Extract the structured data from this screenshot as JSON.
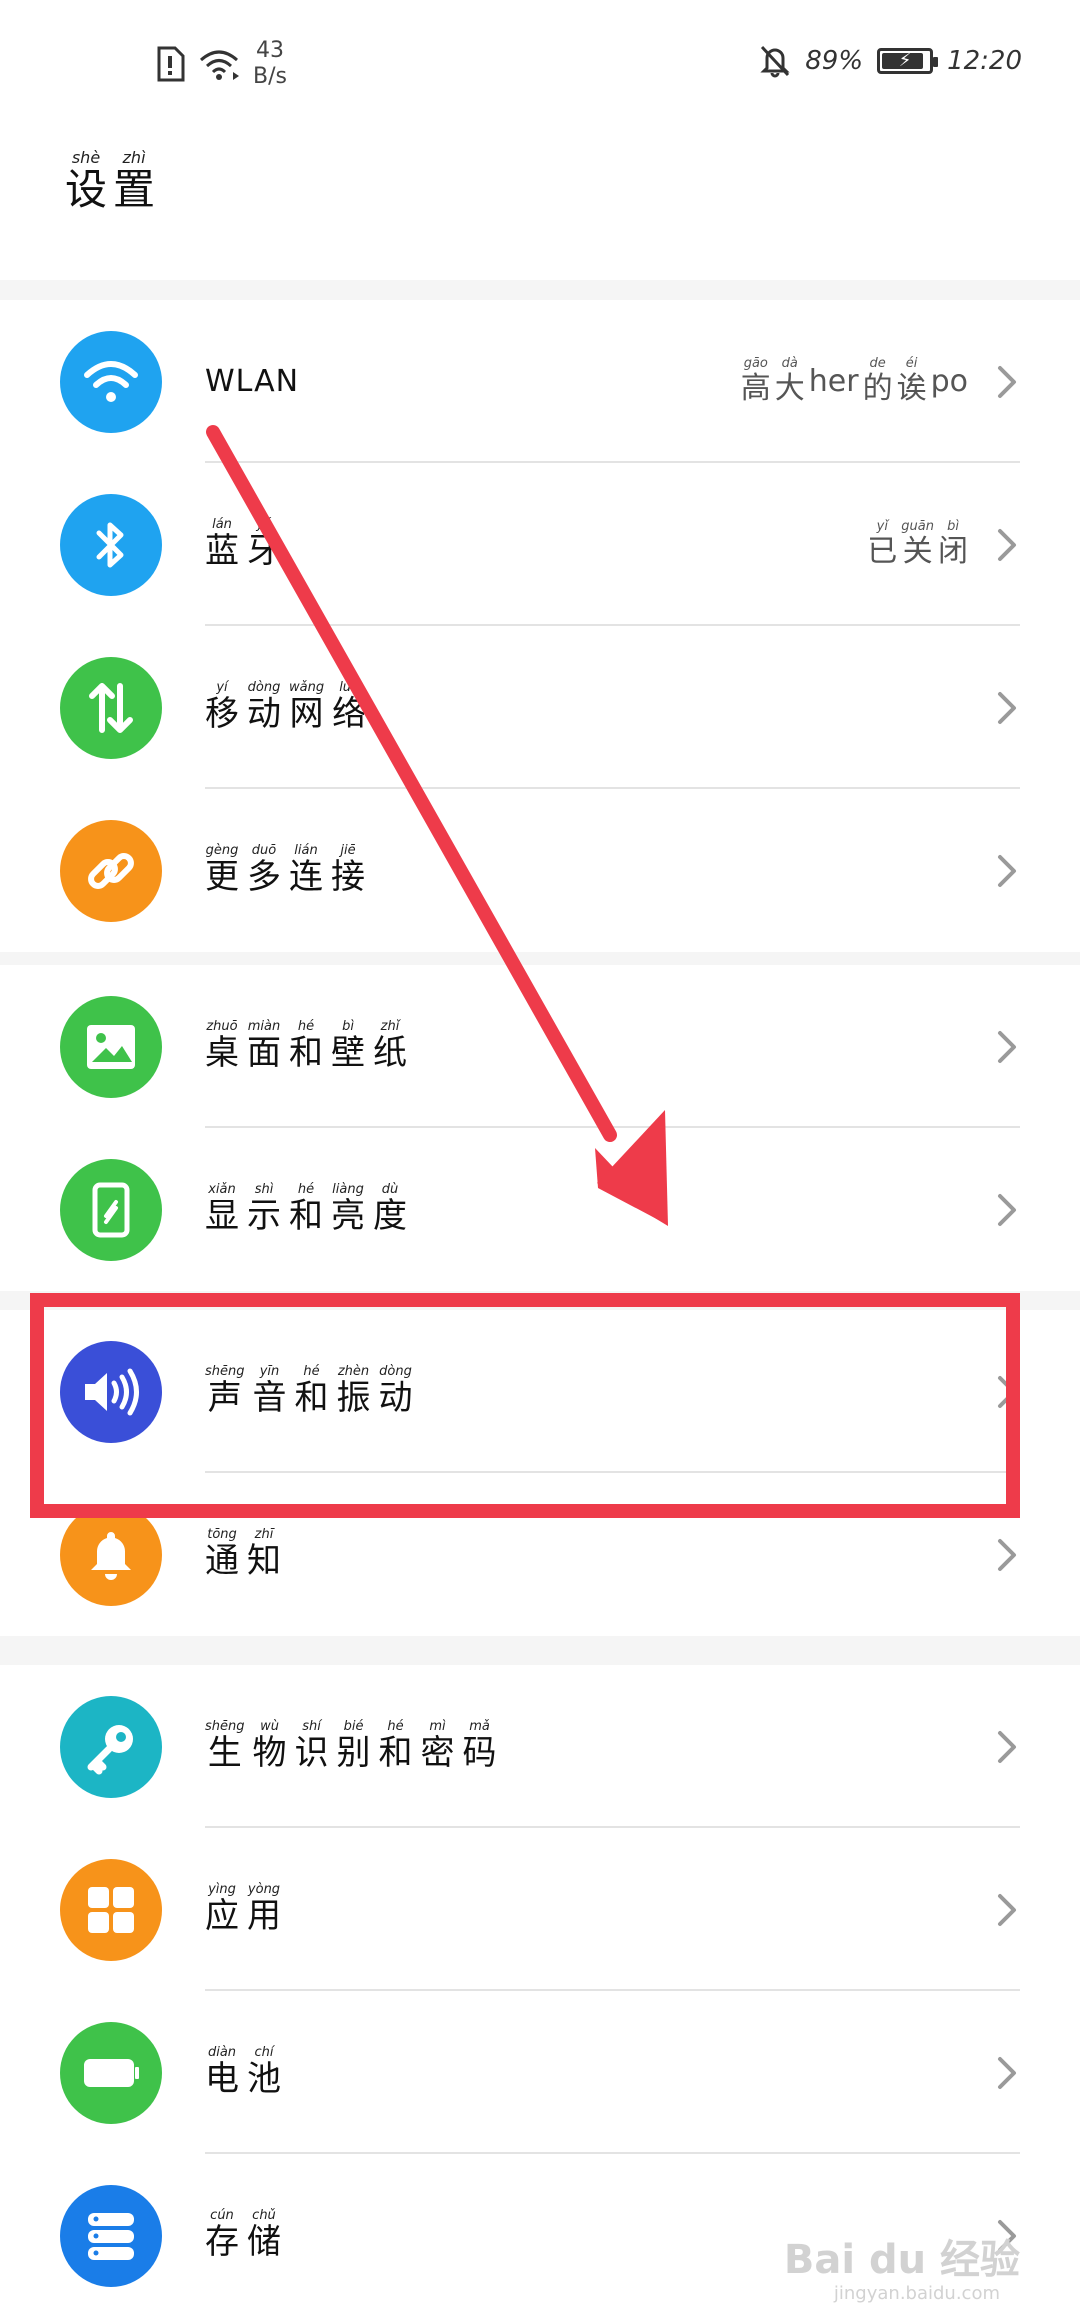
{
  "status_bar": {
    "net_speed_value": "43",
    "net_speed_unit": "B/s",
    "battery": "89%",
    "battery_level": 0.89,
    "time": "12:20"
  },
  "title": {
    "chars": [
      {
        "c": "设",
        "p": "shè"
      },
      {
        "c": "置",
        "p": "zhì"
      }
    ]
  },
  "groups": [
    {
      "rows": [
        {
          "id": "wlan",
          "icon": "wifi-icon",
          "color": "#1fa3f0",
          "label_plain": "WLAN",
          "value": [
            {
              "c": "高",
              "p": "gāo"
            },
            {
              "c": "大",
              "p": "dà"
            },
            {
              "c": "her",
              "p": ""
            },
            {
              "c": "的",
              "p": "de"
            },
            {
              "c": "诶",
              "p": "éi"
            },
            {
              "c": "po",
              "p": ""
            }
          ]
        },
        {
          "id": "bluetooth",
          "icon": "bluetooth-icon",
          "color": "#1fa3f0",
          "label": [
            {
              "c": "蓝",
              "p": "lán"
            },
            {
              "c": "牙",
              "p": "yá"
            }
          ],
          "value": [
            {
              "c": "已",
              "p": "yǐ"
            },
            {
              "c": "关",
              "p": "guān"
            },
            {
              "c": "闭",
              "p": "bì"
            }
          ]
        },
        {
          "id": "mobile-network",
          "icon": "mobile-data-icon",
          "color": "#3fc24a",
          "label": [
            {
              "c": "移",
              "p": "yí"
            },
            {
              "c": "动",
              "p": "dòng"
            },
            {
              "c": "网",
              "p": "wǎng"
            },
            {
              "c": "络",
              "p": "luò"
            }
          ]
        },
        {
          "id": "more-connections",
          "icon": "link-icon",
          "color": "#f7931a",
          "label": [
            {
              "c": "更",
              "p": "gèng"
            },
            {
              "c": "多",
              "p": "duō"
            },
            {
              "c": "连",
              "p": "lián"
            },
            {
              "c": "接",
              "p": "jiē"
            }
          ]
        }
      ]
    },
    {
      "rows": [
        {
          "id": "home-wallpaper",
          "icon": "image-icon",
          "color": "#3fc24a",
          "label": [
            {
              "c": "桌",
              "p": "zhuō"
            },
            {
              "c": "面",
              "p": "miàn"
            },
            {
              "c": "和",
              "p": "hé"
            },
            {
              "c": "壁",
              "p": "bì"
            },
            {
              "c": "纸",
              "p": "zhǐ"
            }
          ]
        },
        {
          "id": "display-brightness",
          "icon": "phone-display-icon",
          "color": "#3fc24a",
          "label": [
            {
              "c": "显",
              "p": "xiǎn"
            },
            {
              "c": "示",
              "p": "shì"
            },
            {
              "c": "和",
              "p": "hé"
            },
            {
              "c": "亮",
              "p": "liàng"
            },
            {
              "c": "度",
              "p": "dù"
            }
          ]
        }
      ]
    },
    {
      "rows": [
        {
          "id": "sound-vibration",
          "icon": "speaker-icon",
          "color": "#3a4fd8",
          "label": [
            {
              "c": "声",
              "p": "shēng"
            },
            {
              "c": "音",
              "p": "yīn"
            },
            {
              "c": "和",
              "p": "hé"
            },
            {
              "c": "振",
              "p": "zhèn"
            },
            {
              "c": "动",
              "p": "dòng"
            }
          ]
        },
        {
          "id": "notifications",
          "icon": "bell-icon",
          "color": "#f7931a",
          "label": [
            {
              "c": "通",
              "p": "tōng"
            },
            {
              "c": "知",
              "p": "zhī"
            }
          ]
        }
      ]
    },
    {
      "rows": [
        {
          "id": "biometrics-password",
          "icon": "key-icon",
          "color": "#1cb5c5",
          "label": [
            {
              "c": "生",
              "p": "shēng"
            },
            {
              "c": "物",
              "p": "wù"
            },
            {
              "c": "识",
              "p": "shí"
            },
            {
              "c": "别",
              "p": "bié"
            },
            {
              "c": "和",
              "p": "hé"
            },
            {
              "c": "密",
              "p": "mì"
            },
            {
              "c": "码",
              "p": "mǎ"
            }
          ]
        },
        {
          "id": "apps",
          "icon": "apps-grid-icon",
          "color": "#f7931a",
          "label": [
            {
              "c": "应",
              "p": "yìng"
            },
            {
              "c": "用",
              "p": "yòng"
            }
          ]
        },
        {
          "id": "battery",
          "icon": "battery-icon",
          "color": "#3fc24a",
          "label": [
            {
              "c": "电",
              "p": "diàn"
            },
            {
              "c": "池",
              "p": "chí"
            }
          ]
        },
        {
          "id": "storage",
          "icon": "storage-icon",
          "color": "#1a7de8",
          "label": [
            {
              "c": "存",
              "p": "cún"
            },
            {
              "c": "储",
              "p": "chǔ"
            }
          ]
        }
      ]
    }
  ],
  "watermark": {
    "text": "Bai du 经验",
    "sub": "jingyan.baidu.com"
  }
}
